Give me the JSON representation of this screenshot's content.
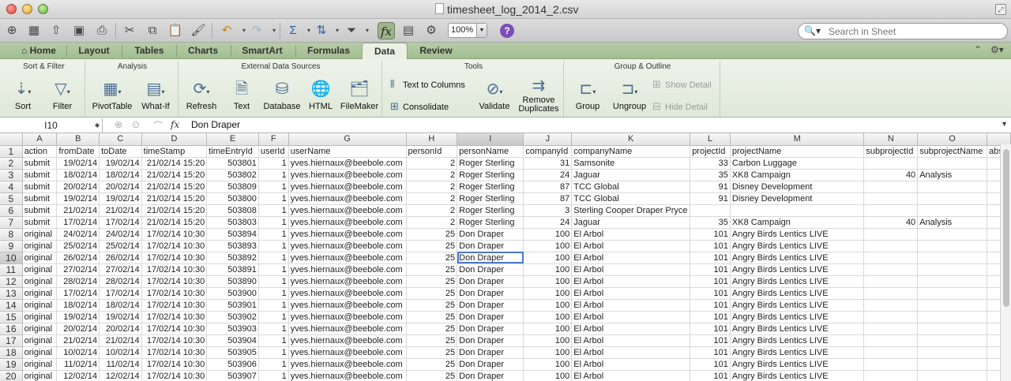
{
  "window": {
    "title": "timesheet_log_2014_2.csv"
  },
  "toolbar": {
    "zoom": "100%",
    "search_placeholder": "Search in Sheet"
  },
  "tabs": [
    "Home",
    "Layout",
    "Tables",
    "Charts",
    "SmartArt",
    "Formulas",
    "Data",
    "Review"
  ],
  "active_tab": "Data",
  "ribbon": {
    "groups": {
      "sort_filter": "Sort & Filter",
      "analysis": "Analysis",
      "external": "External Data Sources",
      "tools": "Tools",
      "group_outline": "Group & Outline"
    },
    "buttons": {
      "sort": "Sort",
      "filter": "Filter",
      "pivot": "PivotTable",
      "whatif": "What-If",
      "refresh": "Refresh",
      "text": "Text",
      "database": "Database",
      "html": "HTML",
      "filemaker": "FileMaker",
      "text_to_columns": "Text to Columns",
      "consolidate": "Consolidate",
      "validate": "Validate",
      "remove_dup_1": "Remove",
      "remove_dup_2": "Duplicates",
      "group": "Group",
      "ungroup": "Ungroup",
      "show_detail": "Show Detail",
      "hide_detail": "Hide Detail"
    }
  },
  "formula_bar": {
    "cell_ref": "I10",
    "value": "Don Draper"
  },
  "sheet": {
    "columns": [
      "A",
      "B",
      "C",
      "D",
      "E",
      "F",
      "G",
      "H",
      "I",
      "J",
      "K",
      "L",
      "M",
      "N",
      "O",
      ""
    ],
    "rows": [
      [
        "action",
        "fromDate",
        "toDate",
        "timeStamp",
        "timeEntryId",
        "userId",
        "userName",
        "personId",
        "personName",
        "companyId",
        "companyName",
        "projectId",
        "projectName",
        "subprojectId",
        "subprojectName",
        "abse"
      ],
      [
        "submit",
        "19/02/14",
        "19/02/14",
        "21/02/14 15:20",
        "503801",
        "1",
        "yves.hiernaux@beebole.com",
        "2",
        "Roger Sterling",
        "31",
        "Samsonite",
        "33",
        "Carbon Luggage",
        "",
        "",
        ""
      ],
      [
        "submit",
        "18/02/14",
        "18/02/14",
        "21/02/14 15:20",
        "503802",
        "1",
        "yves.hiernaux@beebole.com",
        "2",
        "Roger Sterling",
        "24",
        "Jaguar",
        "35",
        "XK8 Campaign",
        "40",
        "Analysis",
        ""
      ],
      [
        "submit",
        "20/02/14",
        "20/02/14",
        "21/02/14 15:20",
        "503809",
        "1",
        "yves.hiernaux@beebole.com",
        "2",
        "Roger Sterling",
        "87",
        "TCC Global",
        "91",
        "Disney Development",
        "",
        "",
        ""
      ],
      [
        "submit",
        "19/02/14",
        "19/02/14",
        "21/02/14 15:20",
        "503800",
        "1",
        "yves.hiernaux@beebole.com",
        "2",
        "Roger Sterling",
        "87",
        "TCC Global",
        "91",
        "Disney Development",
        "",
        "",
        ""
      ],
      [
        "submit",
        "21/02/14",
        "21/02/14",
        "21/02/14 15:20",
        "503808",
        "1",
        "yves.hiernaux@beebole.com",
        "2",
        "Roger Sterling",
        "3",
        "Sterling Cooper Draper Pryce",
        "",
        "",
        "",
        "",
        ""
      ],
      [
        "submit",
        "17/02/14",
        "17/02/14",
        "21/02/14 15:20",
        "503803",
        "1",
        "yves.hiernaux@beebole.com",
        "2",
        "Roger Sterling",
        "24",
        "Jaguar",
        "35",
        "XK8 Campaign",
        "40",
        "Analysis",
        ""
      ],
      [
        "original",
        "24/02/14",
        "24/02/14",
        "17/02/14 10:30",
        "503894",
        "1",
        "yves.hiernaux@beebole.com",
        "25",
        "Don Draper",
        "100",
        "El Arbol",
        "101",
        "Angry Birds Lentics LIVE",
        "",
        "",
        ""
      ],
      [
        "original",
        "25/02/14",
        "25/02/14",
        "17/02/14 10:30",
        "503893",
        "1",
        "yves.hiernaux@beebole.com",
        "25",
        "Don Draper",
        "100",
        "El Arbol",
        "101",
        "Angry Birds Lentics LIVE",
        "",
        "",
        ""
      ],
      [
        "original",
        "26/02/14",
        "26/02/14",
        "17/02/14 10:30",
        "503892",
        "1",
        "yves.hiernaux@beebole.com",
        "25",
        "Don Draper",
        "100",
        "El Arbol",
        "101",
        "Angry Birds Lentics LIVE",
        "",
        "",
        ""
      ],
      [
        "original",
        "27/02/14",
        "27/02/14",
        "17/02/14 10:30",
        "503891",
        "1",
        "yves.hiernaux@beebole.com",
        "25",
        "Don Draper",
        "100",
        "El Arbol",
        "101",
        "Angry Birds Lentics LIVE",
        "",
        "",
        ""
      ],
      [
        "original",
        "28/02/14",
        "28/02/14",
        "17/02/14 10:30",
        "503890",
        "1",
        "yves.hiernaux@beebole.com",
        "25",
        "Don Draper",
        "100",
        "El Arbol",
        "101",
        "Angry Birds Lentics LIVE",
        "",
        "",
        ""
      ],
      [
        "original",
        "17/02/14",
        "17/02/14",
        "17/02/14 10:30",
        "503900",
        "1",
        "yves.hiernaux@beebole.com",
        "25",
        "Don Draper",
        "100",
        "El Arbol",
        "101",
        "Angry Birds Lentics LIVE",
        "",
        "",
        ""
      ],
      [
        "original",
        "18/02/14",
        "18/02/14",
        "17/02/14 10:30",
        "503901",
        "1",
        "yves.hiernaux@beebole.com",
        "25",
        "Don Draper",
        "100",
        "El Arbol",
        "101",
        "Angry Birds Lentics LIVE",
        "",
        "",
        ""
      ],
      [
        "original",
        "19/02/14",
        "19/02/14",
        "17/02/14 10:30",
        "503902",
        "1",
        "yves.hiernaux@beebole.com",
        "25",
        "Don Draper",
        "100",
        "El Arbol",
        "101",
        "Angry Birds Lentics LIVE",
        "",
        "",
        ""
      ],
      [
        "original",
        "20/02/14",
        "20/02/14",
        "17/02/14 10:30",
        "503903",
        "1",
        "yves.hiernaux@beebole.com",
        "25",
        "Don Draper",
        "100",
        "El Arbol",
        "101",
        "Angry Birds Lentics LIVE",
        "",
        "",
        ""
      ],
      [
        "original",
        "21/02/14",
        "21/02/14",
        "17/02/14 10:30",
        "503904",
        "1",
        "yves.hiernaux@beebole.com",
        "25",
        "Don Draper",
        "100",
        "El Arbol",
        "101",
        "Angry Birds Lentics LIVE",
        "",
        "",
        ""
      ],
      [
        "original",
        "10/02/14",
        "10/02/14",
        "17/02/14 10:30",
        "503905",
        "1",
        "yves.hiernaux@beebole.com",
        "25",
        "Don Draper",
        "100",
        "El Arbol",
        "101",
        "Angry Birds Lentics LIVE",
        "",
        "",
        ""
      ],
      [
        "original",
        "11/02/14",
        "11/02/14",
        "17/02/14 10:30",
        "503906",
        "1",
        "yves.hiernaux@beebole.com",
        "25",
        "Don Draper",
        "100",
        "El Arbol",
        "101",
        "Angry Birds Lentics LIVE",
        "",
        "",
        ""
      ],
      [
        "original",
        "12/02/14",
        "12/02/14",
        "17/02/14 10:30",
        "503907",
        "1",
        "yves.hiernaux@beebole.com",
        "25",
        "Don Draper",
        "100",
        "El Arbol",
        "101",
        "Angry Birds Lentics LIVE",
        "",
        "",
        ""
      ]
    ]
  }
}
